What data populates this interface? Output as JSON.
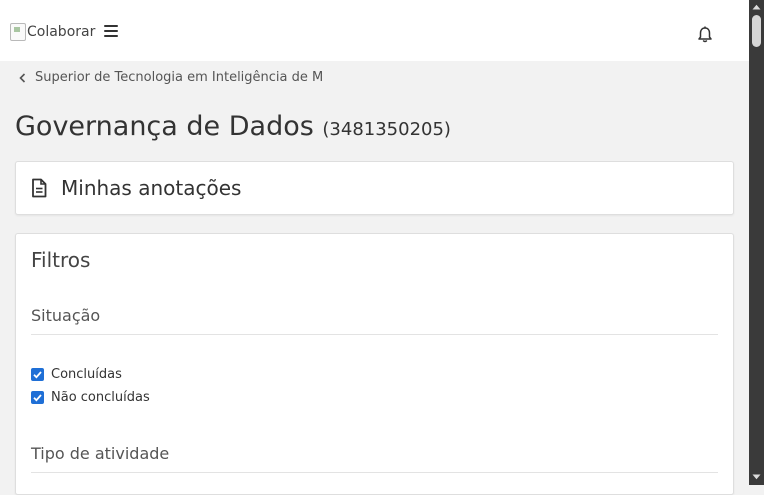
{
  "header": {
    "logo_alt": "Colaborar"
  },
  "breadcrumb": {
    "label": "Superior de Tecnologia em Inteligência de M"
  },
  "page": {
    "title": "Governança de Dados",
    "code": "(3481350205)"
  },
  "notes": {
    "label": "Minhas anotações"
  },
  "filters": {
    "title": "Filtros",
    "situacao": {
      "label": "Situação",
      "options": [
        {
          "label": "Concluídas",
          "checked": true
        },
        {
          "label": "Não concluídas",
          "checked": true
        }
      ]
    },
    "tipo": {
      "label": "Tipo de atividade"
    }
  },
  "colors": {
    "accent": "#1f6fd6",
    "scrollbar": "#3a3a3a",
    "background": "#f2f2f2"
  },
  "icons": [
    "broken-image-icon",
    "menu-icon",
    "bell-icon",
    "chevron-left-icon",
    "document-icon",
    "checkbox-checked-icon"
  ]
}
